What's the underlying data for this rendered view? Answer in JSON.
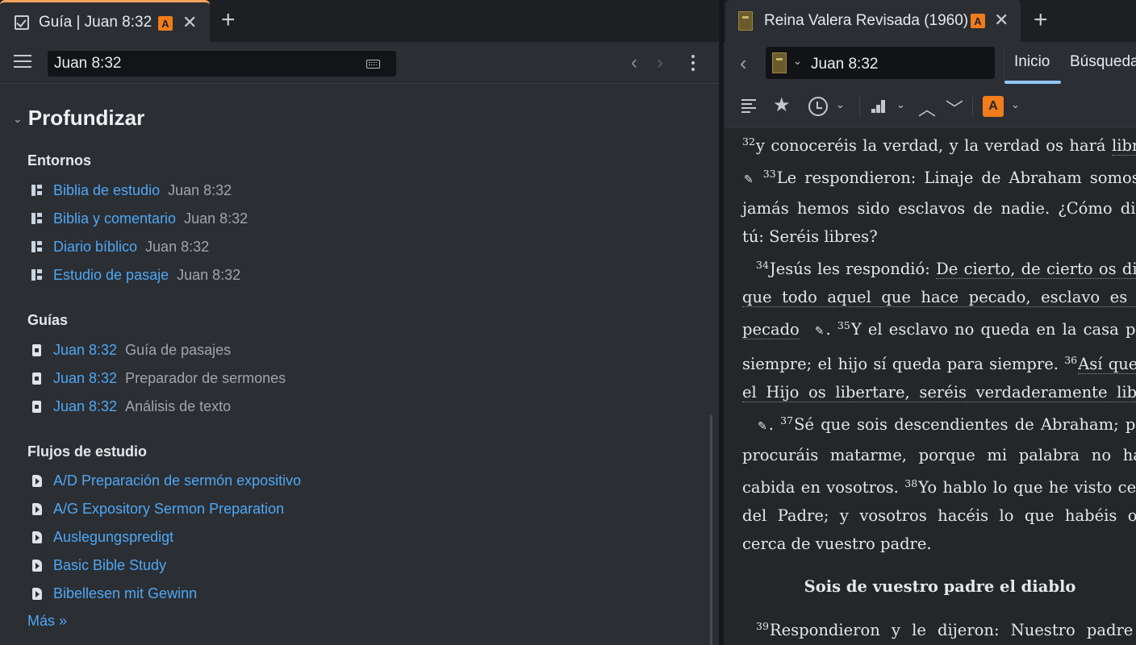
{
  "left": {
    "tab": {
      "title": "Guía | Juan 8:32",
      "badge": "A",
      "close": "✕",
      "add": "+"
    },
    "toolbar": {
      "reference": "Juan 8:32",
      "back": "‹",
      "forward": "›"
    },
    "section_title": "Profundizar",
    "groups": {
      "entornos": {
        "title": "Entornos",
        "items": [
          {
            "link": "Biblia de estudio",
            "meta": "Juan 8:32"
          },
          {
            "link": "Biblia y comentario",
            "meta": "Juan 8:32"
          },
          {
            "link": "Diario bíblico",
            "meta": "Juan 8:32"
          },
          {
            "link": "Estudio de pasaje",
            "meta": "Juan 8:32"
          }
        ]
      },
      "guias": {
        "title": "Guías",
        "items": [
          {
            "link": "Juan 8:32",
            "meta": "Guía de pasajes"
          },
          {
            "link": "Juan 8:32",
            "meta": "Preparador de sermones"
          },
          {
            "link": "Juan 8:32",
            "meta": "Análisis de texto"
          }
        ]
      },
      "flujos": {
        "title": "Flujos de estudio",
        "items": [
          {
            "link": "A/D Preparación de sermón expositivo"
          },
          {
            "link": "A/G Expository Sermon Preparation"
          },
          {
            "link": "Auslegungspredigt"
          },
          {
            "link": "Basic Bible Study"
          },
          {
            "link": "Bibellesen mit Gewinn"
          }
        ]
      }
    },
    "more": "Más »"
  },
  "right": {
    "tab": {
      "title": "Reina Valera Revisada (1960)",
      "badge": "A",
      "close": "✕",
      "add": "+"
    },
    "toolbar": {
      "back": "‹",
      "reference": "Juan 8:32",
      "tab_inicio": "Inicio",
      "tab_busqueda": "Búsqueda"
    },
    "toolbar2": {
      "star": "★",
      "up": "︿",
      "down": "﹀",
      "caret": "⌄",
      "a_badge": "A"
    },
    "text": {
      "v32_num": "32",
      "v32": "y conoceréis la verdad, y la verdad os hará",
      "v32_ul": "libres.",
      "v33_num": "33",
      "v33": "Le respondieron: Linaje de Abraham somos, y jamás hemos sido esclavos de nadie. ¿Cómo dices tú: Seréis libres?",
      "v34_num": "34",
      "v34_a": "Jesús les respondió: ",
      "v34_ul": "De cierto, de cierto os digo, que todo aquel que hace pecado, esclavo es del pecado",
      "v34_end": ".",
      "v35_num": "35",
      "v35": "Y el esclavo no queda en la casa para siempre; el hijo sí queda para siempre.",
      "v36_num": "36",
      "v36_ul": "Así que, si el Hijo os libertare, seréis verdaderamente libres",
      "v36_end": ".",
      "v37_num": "37",
      "v37": "Sé que sois descendientes de Abraham; pero procuráis matarme, porque mi palabra no halla cabida en vosotros.",
      "v38_num": "38",
      "v38": "Yo hablo lo que he visto cerca del Padre; y vosotros hacéis lo que habéis oído cerca de vuestro padre.",
      "heading": "Sois de vuestro padre el diablo",
      "v39_num": "39",
      "v39": "Respondieron y le dijeron: Nuestro padre es Abraham."
    }
  }
}
